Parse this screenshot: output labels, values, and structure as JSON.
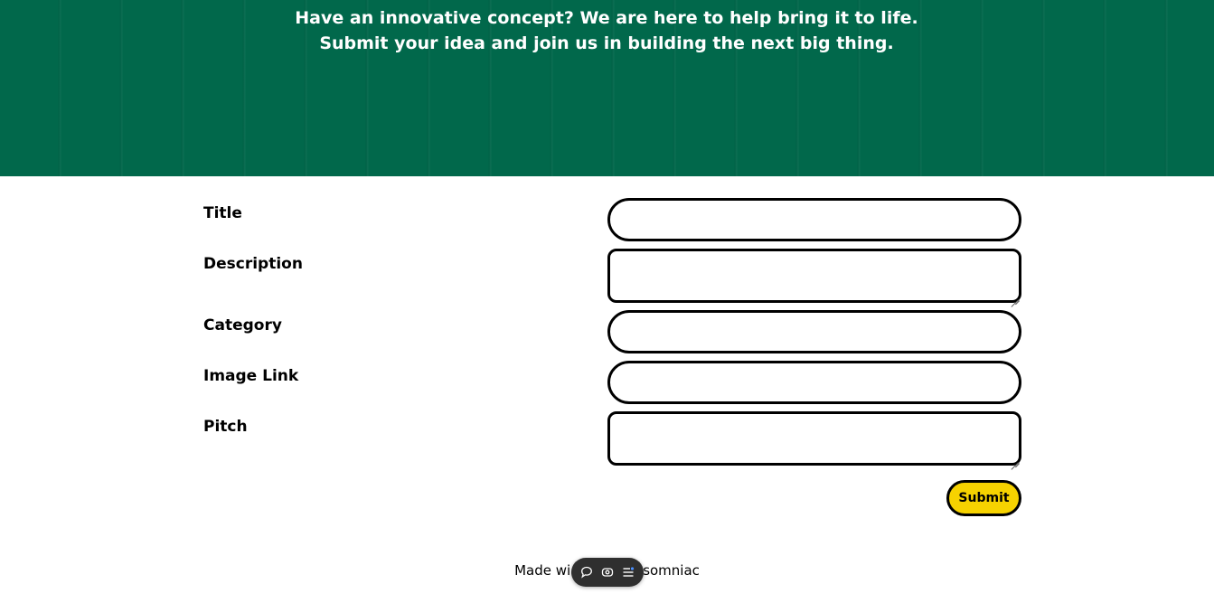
{
  "hero": {
    "headline": "Have an innovative concept? We are here to help bring it to life. Submit your idea and join us in building the next big thing.",
    "background_color": "#01684b"
  },
  "form": {
    "fields": [
      {
        "label": "Title",
        "value": "",
        "type": "input"
      },
      {
        "label": "Description",
        "value": "",
        "type": "textarea"
      },
      {
        "label": "Category",
        "value": "",
        "type": "input"
      },
      {
        "label": "Image Link",
        "value": "",
        "type": "input"
      },
      {
        "label": "Pitch",
        "value": "",
        "type": "textarea"
      }
    ],
    "submit_label": "Submit",
    "submit_color": "#f6d200"
  },
  "footer": {
    "text_left": "Made wi",
    "text_right": "somniac"
  },
  "toolbar": {
    "icons": [
      "comment-icon",
      "eye-icon",
      "menu-list-icon"
    ]
  }
}
